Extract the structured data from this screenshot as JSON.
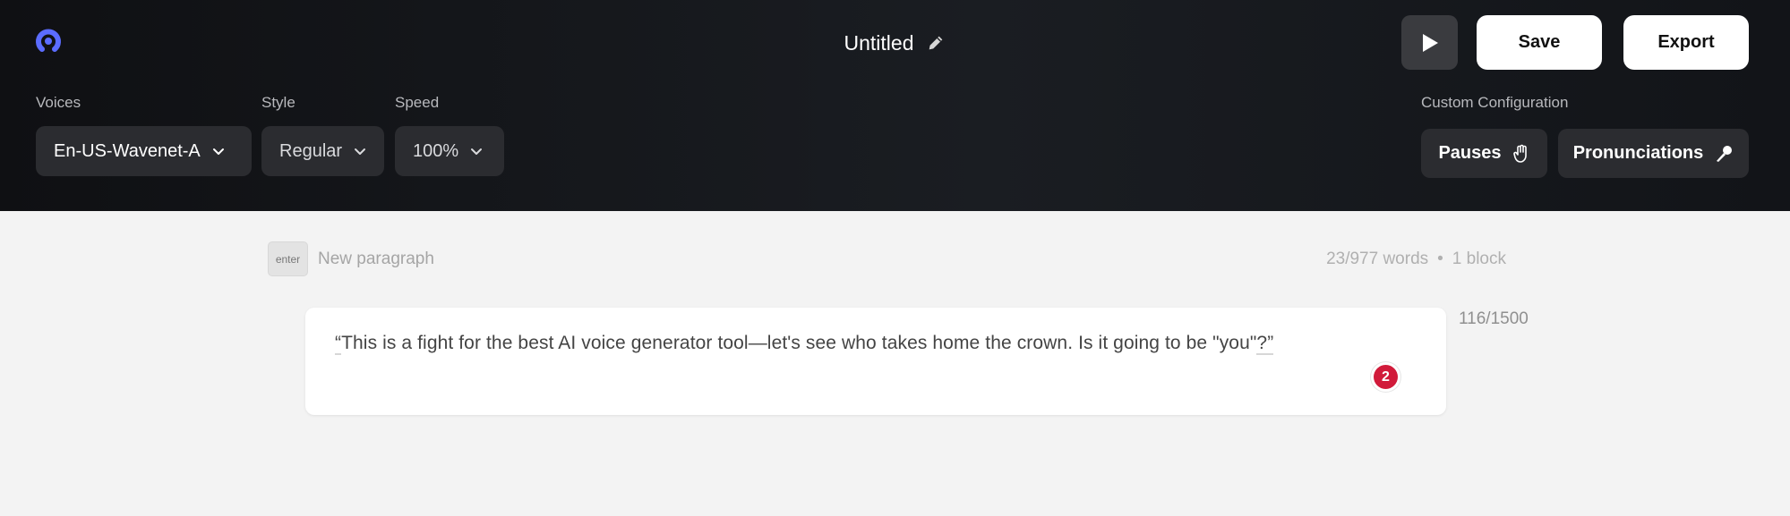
{
  "header": {
    "title": "Untitled",
    "save_label": "Save",
    "export_label": "Export"
  },
  "controls": {
    "voices_label": "Voices",
    "voice_value": "En-US-Wavenet-A",
    "style_label": "Style",
    "style_value": "Regular",
    "speed_label": "Speed",
    "speed_value": "100%",
    "custom_config_label": "Custom Configuration",
    "pauses_label": "Pauses",
    "pronunciations_label": "Pronunciations"
  },
  "editor": {
    "enter_key": "enter",
    "new_paragraph": "New paragraph",
    "word_count": "23/977 words",
    "separator": "•",
    "block_count": "1 block",
    "block": {
      "quote_open": "“",
      "text_main": "This is a fight for the best AI voice generator tool—let's see who takes home the crown. Is it going to be \"you\"",
      "text_end": "?”",
      "char_count": "116/1500",
      "badge": "2"
    }
  },
  "colors": {
    "accent": "#5b6cff",
    "badge": "#d11a3a",
    "header_bg": "#14161a"
  },
  "icons": [
    "app-logo-icon",
    "pencil-icon",
    "play-icon",
    "chevron-down-icon",
    "hand-icon",
    "microphone-icon"
  ]
}
